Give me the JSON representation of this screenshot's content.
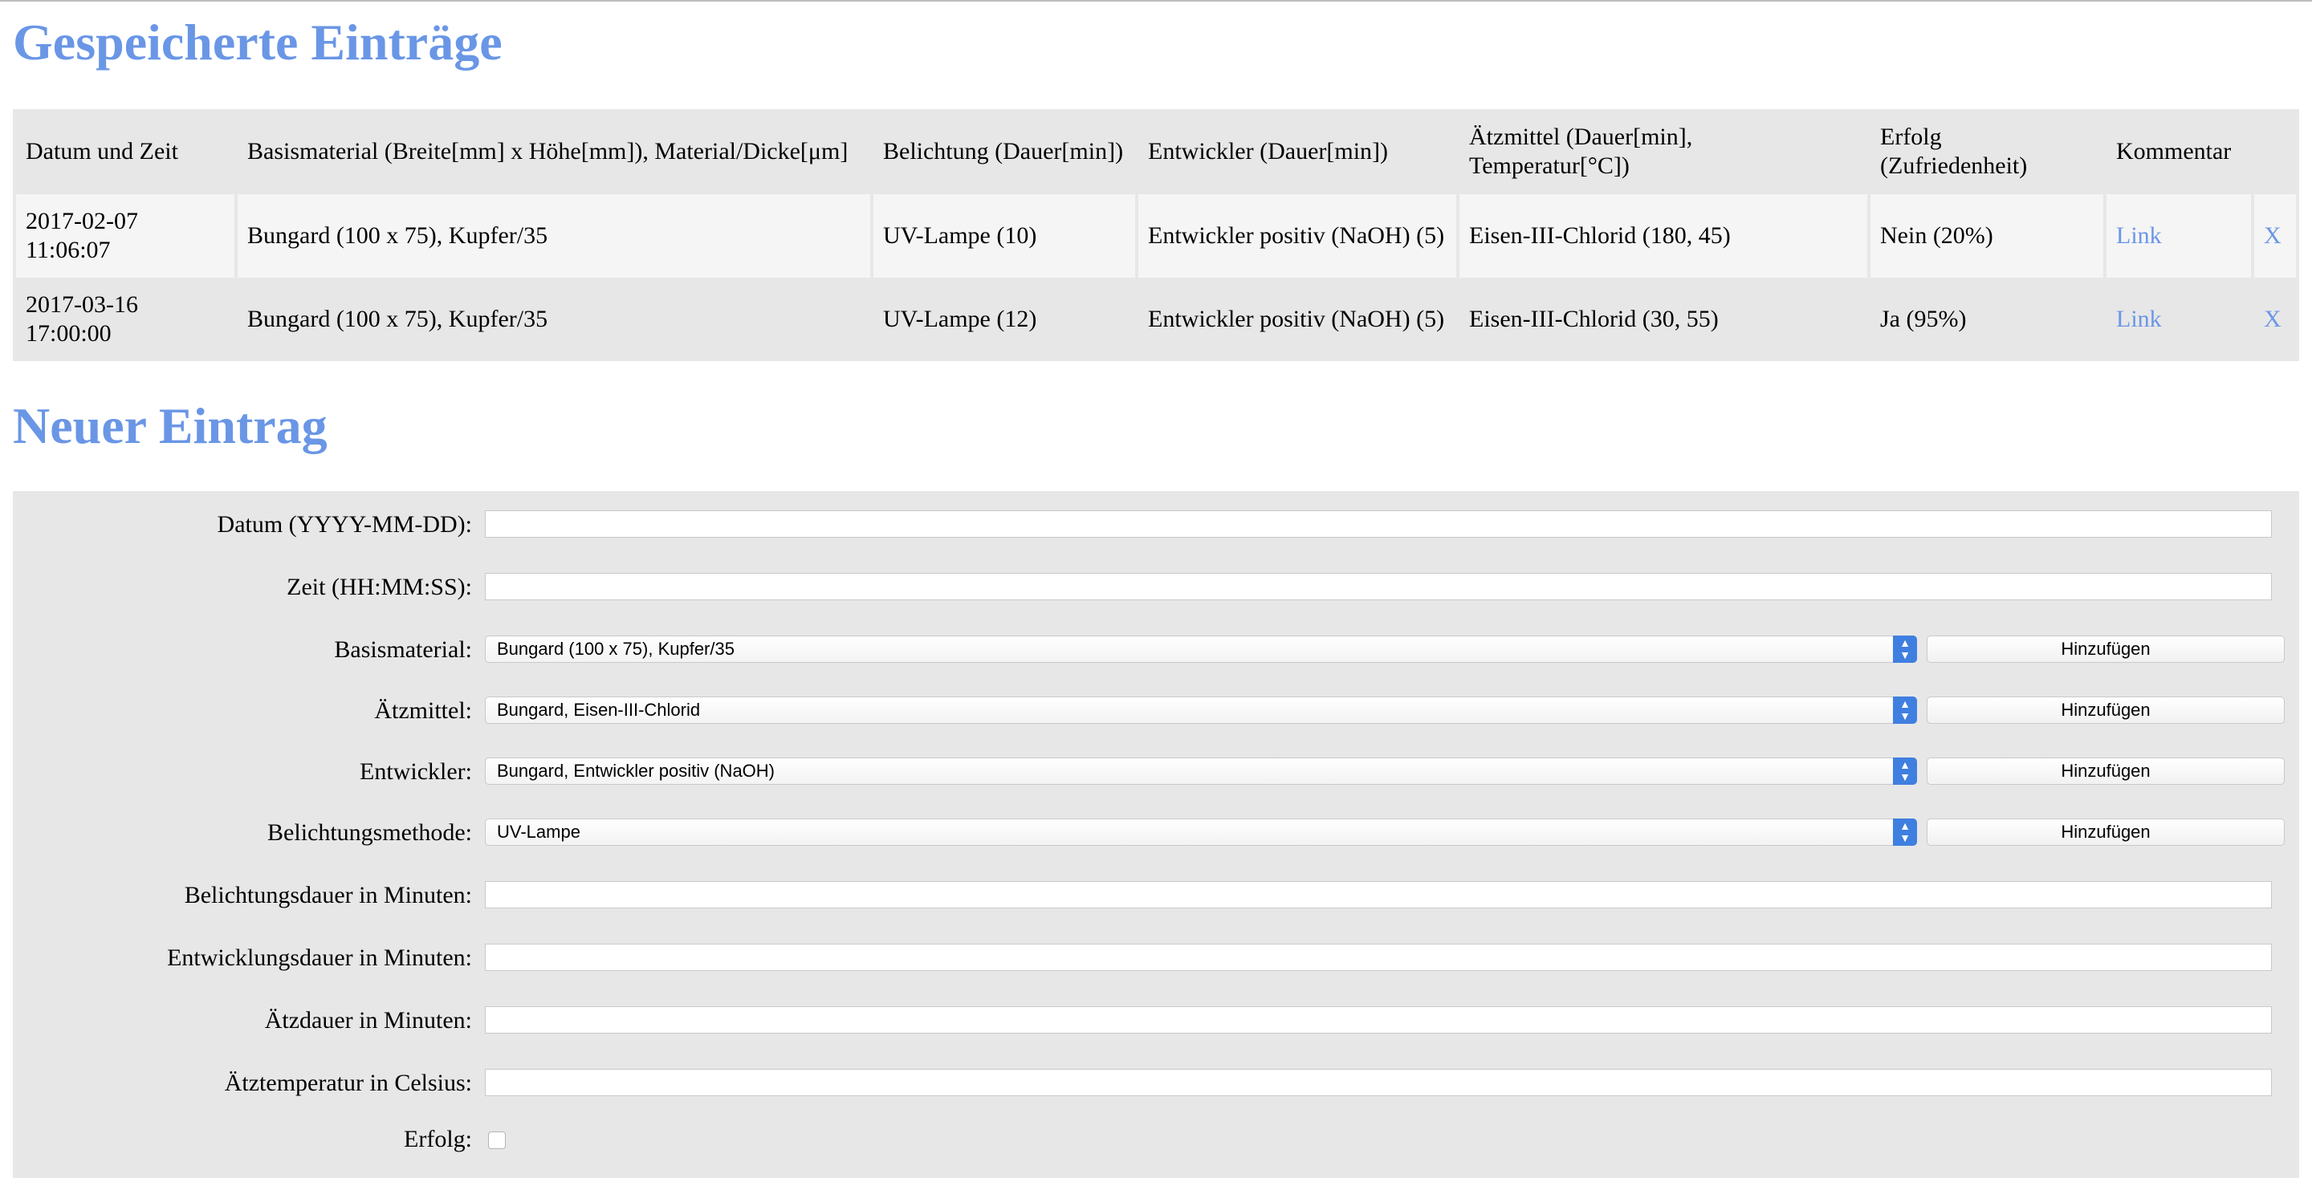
{
  "saved": {
    "heading": "Gespeicherte Einträge",
    "headers": [
      "Datum und Zeit",
      "Basismaterial (Breite[mm] x Höhe[mm]), Material/Dicke[μm]",
      "Belichtung (Dauer[min])",
      "Entwickler (Dauer[min])",
      "Ätzmittel (Dauer[min], Temperatur[°C])",
      "Erfolg (Zufriedenheit)",
      "Kommentar",
      ""
    ],
    "rows": [
      {
        "datetime_date": "2017-02-07",
        "datetime_time": "11:06:07",
        "basismaterial": "Bungard (100 x 75), Kupfer/35",
        "belichtung": "UV-Lampe (10)",
        "entwickler": "Entwickler positiv (NaOH) (5)",
        "aetzmittel": "Eisen-III-Chlorid (180, 45)",
        "erfolg": "Nein (20%)",
        "kommentar_link": "Link",
        "delete": "X"
      },
      {
        "datetime_date": "2017-03-16",
        "datetime_time": "17:00:00",
        "basismaterial": "Bungard (100 x 75), Kupfer/35",
        "belichtung": "UV-Lampe (12)",
        "entwickler": "Entwickler positiv (NaOH) (5)",
        "aetzmittel": "Eisen-III-Chlorid (30, 55)",
        "erfolg": "Ja (95%)",
        "kommentar_link": "Link",
        "delete": "X"
      }
    ]
  },
  "new_entry": {
    "heading": "Neuer Eintrag",
    "datum_label": "Datum (YYYY-MM-DD):",
    "datum_value": "",
    "zeit_label": "Zeit (HH:MM:SS):",
    "zeit_value": "",
    "basismaterial_label": "Basismaterial:",
    "basismaterial_selected": "Bungard (100 x 75), Kupfer/35",
    "aetzmittel_label": "Ätzmittel:",
    "aetzmittel_selected": "Bungard, Eisen-III-Chlorid",
    "entwickler_label": "Entwickler:",
    "entwickler_selected": "Bungard, Entwickler positiv (NaOH)",
    "belichtungsmethode_label": "Belichtungsmethode:",
    "belichtungsmethode_selected": "UV-Lampe",
    "add_button_label": "Hinzufügen",
    "belichtungsdauer_label": "Belichtungsdauer in Minuten:",
    "entwicklungsdauer_label": "Entwicklungsdauer in Minuten:",
    "aetzdauer_label": "Ätzdauer in Minuten:",
    "aetztemperatur_label": "Ätztemperatur in Celsius:",
    "erfolg_label": "Erfolg:",
    "erfolg_checked": false
  },
  "colors": {
    "heading": "#6a96e6",
    "link": "#6a96e6",
    "select_arrow": "#3f7fe0",
    "panel_bg": "#e7e7e7"
  },
  "icons": {
    "select_arrow": "chevron-up-down-icon"
  }
}
